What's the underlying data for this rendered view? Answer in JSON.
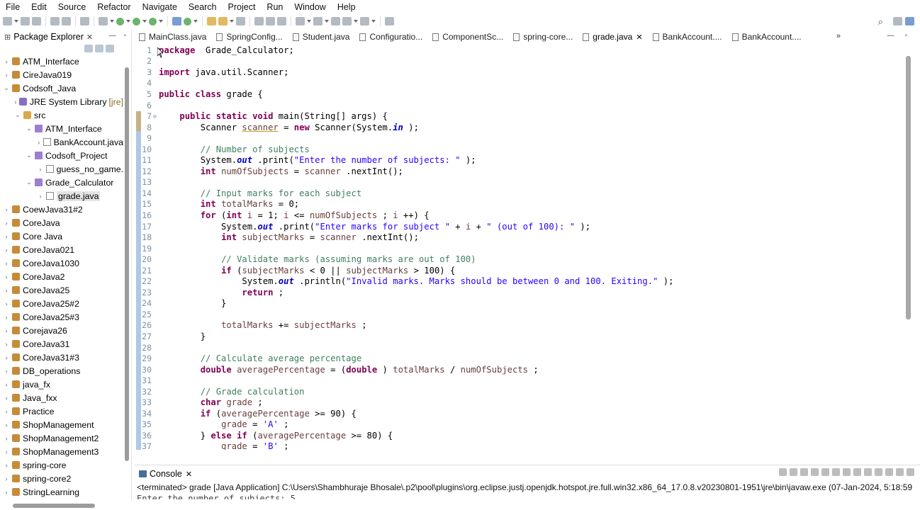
{
  "menu": [
    "File",
    "Edit",
    "Source",
    "Refactor",
    "Navigate",
    "Search",
    "Project",
    "Run",
    "Window",
    "Help"
  ],
  "package_explorer": {
    "title": "Package Explorer",
    "items": [
      {
        "label": "ATM_Interface",
        "depth": 0,
        "twisty": "›",
        "icon": "project"
      },
      {
        "label": "CireJava019",
        "depth": 0,
        "twisty": "›",
        "icon": "project"
      },
      {
        "label": "Codsoft_Java",
        "depth": 0,
        "twisty": "⌄",
        "icon": "project"
      },
      {
        "label": "JRE System Library",
        "decoration": "[jre]",
        "depth": 1,
        "twisty": "›",
        "icon": "library"
      },
      {
        "label": "src",
        "depth": 1,
        "twisty": "⌄",
        "icon": "source-folder"
      },
      {
        "label": "ATM_Interface",
        "depth": 2,
        "twisty": "⌄",
        "icon": "package"
      },
      {
        "label": "BankAccount.java",
        "depth": 3,
        "twisty": "›",
        "icon": "java-file"
      },
      {
        "label": "Codsoft_Project",
        "depth": 2,
        "twisty": "⌄",
        "icon": "package"
      },
      {
        "label": "guess_no_game.",
        "depth": 3,
        "twisty": "›",
        "icon": "java-file"
      },
      {
        "label": "Grade_Calculator",
        "depth": 2,
        "twisty": "⌄",
        "icon": "package"
      },
      {
        "label": "grade.java",
        "depth": 3,
        "twisty": "›",
        "icon": "java-file",
        "selected": true
      },
      {
        "label": "CoewJava31#2",
        "depth": 0,
        "twisty": "›",
        "icon": "project"
      },
      {
        "label": "CoreJava",
        "depth": 0,
        "twisty": "›",
        "icon": "project"
      },
      {
        "label": "Core Java",
        "depth": 0,
        "twisty": "›",
        "icon": "project"
      },
      {
        "label": "CoreJava021",
        "depth": 0,
        "twisty": "›",
        "icon": "project"
      },
      {
        "label": "CoreJava1030",
        "depth": 0,
        "twisty": "›",
        "icon": "project"
      },
      {
        "label": "CoreJava2",
        "depth": 0,
        "twisty": "›",
        "icon": "project"
      },
      {
        "label": "CoreJava25",
        "depth": 0,
        "twisty": "›",
        "icon": "project"
      },
      {
        "label": "CoreJava25#2",
        "depth": 0,
        "twisty": "›",
        "icon": "project"
      },
      {
        "label": "CoreJava25#3",
        "depth": 0,
        "twisty": "›",
        "icon": "project"
      },
      {
        "label": "Corejava26",
        "depth": 0,
        "twisty": "›",
        "icon": "project"
      },
      {
        "label": "CoreJava31",
        "depth": 0,
        "twisty": "›",
        "icon": "project"
      },
      {
        "label": "CoreJava31#3",
        "depth": 0,
        "twisty": "›",
        "icon": "project"
      },
      {
        "label": "DB_operations",
        "depth": 0,
        "twisty": "›",
        "icon": "project"
      },
      {
        "label": "java_fx",
        "depth": 0,
        "twisty": "›",
        "icon": "project"
      },
      {
        "label": "Java_fxx",
        "depth": 0,
        "twisty": "›",
        "icon": "project"
      },
      {
        "label": "Practice",
        "depth": 0,
        "twisty": "›",
        "icon": "project"
      },
      {
        "label": "ShopManagement",
        "depth": 0,
        "twisty": "›",
        "icon": "project"
      },
      {
        "label": "ShopManagement2",
        "depth": 0,
        "twisty": "›",
        "icon": "project"
      },
      {
        "label": "ShopManagement3",
        "depth": 0,
        "twisty": "›",
        "icon": "project"
      },
      {
        "label": "spring-core",
        "depth": 0,
        "twisty": "›",
        "icon": "project"
      },
      {
        "label": "spring-core2",
        "depth": 0,
        "twisty": "›",
        "icon": "project"
      },
      {
        "label": "StringLearning",
        "depth": 0,
        "twisty": "›",
        "icon": "project"
      }
    ]
  },
  "editor_tabs": [
    {
      "label": "MainClass.java",
      "active": false
    },
    {
      "label": "SpringConfig...",
      "active": false
    },
    {
      "label": "Student.java",
      "active": false
    },
    {
      "label": "Configuratio...",
      "active": false
    },
    {
      "label": "ComponentSc...",
      "active": false
    },
    {
      "label": "spring-core...",
      "active": false
    },
    {
      "label": "grade.java",
      "active": true
    },
    {
      "label": "BankAccount....",
      "active": false
    },
    {
      "label": "BankAccount....",
      "active": false
    }
  ],
  "tabs_overflow": "»",
  "code_lines": [
    {
      "n": "1",
      "fold": "",
      "tokens": [
        [
          "kw",
          "package"
        ],
        [
          "",
          "  Grade_Calculator;"
        ]
      ]
    },
    {
      "n": "2",
      "fold": "",
      "tokens": []
    },
    {
      "n": "3",
      "fold": "",
      "tokens": [
        [
          "kw",
          "import"
        ],
        [
          "",
          " java.util.Scanner;"
        ]
      ]
    },
    {
      "n": "4",
      "fold": "",
      "tokens": []
    },
    {
      "n": "5",
      "fold": "",
      "tokens": [
        [
          "kw",
          "public class"
        ],
        [
          "",
          " grade {"
        ]
      ]
    },
    {
      "n": "6",
      "fold": "",
      "tokens": []
    },
    {
      "n": "7",
      "fold": "⊖",
      "tokens": [
        [
          "",
          "    "
        ],
        [
          "kw",
          "public static void"
        ],
        [
          "",
          " main(String[] args) {"
        ]
      ]
    },
    {
      "n": "8",
      "fold": "",
      "tokens": [
        [
          "",
          "        Scanner "
        ],
        [
          "ul",
          "scanner"
        ],
        [
          "",
          " = "
        ],
        [
          "kw",
          "new"
        ],
        [
          "",
          " Scanner(System."
        ],
        [
          "fld",
          "in"
        ],
        [
          "",
          " );"
        ]
      ]
    },
    {
      "n": "9",
      "fold": "",
      "tokens": []
    },
    {
      "n": "10",
      "fold": "",
      "tokens": [
        [
          "",
          "        "
        ],
        [
          "cm",
          "// Number of subjects"
        ]
      ]
    },
    {
      "n": "11",
      "fold": "",
      "tokens": [
        [
          "",
          "        System."
        ],
        [
          "fld",
          "out"
        ],
        [
          "",
          " .print("
        ],
        [
          "st",
          "\"Enter the number of subjects: \""
        ],
        [
          "",
          " );"
        ]
      ]
    },
    {
      "n": "12",
      "fold": "",
      "tokens": [
        [
          "",
          "        "
        ],
        [
          "kw",
          "int"
        ],
        [
          "",
          " "
        ],
        [
          "vr",
          "numOfSubjects"
        ],
        [
          "",
          " = "
        ],
        [
          "vr",
          "scanner"
        ],
        [
          "",
          " .nextInt();"
        ]
      ]
    },
    {
      "n": "13",
      "fold": "",
      "tokens": []
    },
    {
      "n": "14",
      "fold": "",
      "tokens": [
        [
          "",
          "        "
        ],
        [
          "cm",
          "// Input marks for each subject"
        ]
      ]
    },
    {
      "n": "15",
      "fold": "",
      "tokens": [
        [
          "",
          "        "
        ],
        [
          "kw",
          "int"
        ],
        [
          "",
          " "
        ],
        [
          "vr",
          "totalMarks"
        ],
        [
          "",
          " = 0;"
        ]
      ]
    },
    {
      "n": "16",
      "fold": "",
      "tokens": [
        [
          "",
          "        "
        ],
        [
          "kw",
          "for"
        ],
        [
          "",
          " ("
        ],
        [
          "kw",
          "int"
        ],
        [
          "",
          " "
        ],
        [
          "vr",
          "i"
        ],
        [
          "",
          " = 1; "
        ],
        [
          "vr",
          "i"
        ],
        [
          "",
          " <= "
        ],
        [
          "vr",
          "numOfSubjects"
        ],
        [
          "",
          " ; "
        ],
        [
          "vr",
          "i"
        ],
        [
          "",
          " ++) {"
        ]
      ]
    },
    {
      "n": "17",
      "fold": "",
      "tokens": [
        [
          "",
          "            System."
        ],
        [
          "fld",
          "out"
        ],
        [
          "",
          " .print("
        ],
        [
          "st",
          "\"Enter marks for subject \""
        ],
        [
          "",
          " + "
        ],
        [
          "vr",
          "i"
        ],
        [
          "",
          " + "
        ],
        [
          "st",
          "\" (out of 100): \""
        ],
        [
          "",
          " );"
        ]
      ]
    },
    {
      "n": "18",
      "fold": "",
      "tokens": [
        [
          "",
          "            "
        ],
        [
          "kw",
          "int"
        ],
        [
          "",
          " "
        ],
        [
          "vr",
          "subjectMarks"
        ],
        [
          "",
          " = "
        ],
        [
          "vr",
          "scanner"
        ],
        [
          "",
          " .nextInt();"
        ]
      ]
    },
    {
      "n": "19",
      "fold": "",
      "tokens": []
    },
    {
      "n": "20",
      "fold": "",
      "tokens": [
        [
          "",
          "            "
        ],
        [
          "cm",
          "// Validate marks (assuming marks are out of 100)"
        ]
      ]
    },
    {
      "n": "21",
      "fold": "",
      "tokens": [
        [
          "",
          "            "
        ],
        [
          "kw",
          "if"
        ],
        [
          "",
          " ("
        ],
        [
          "vr",
          "subjectMarks"
        ],
        [
          "",
          " < 0 || "
        ],
        [
          "vr",
          "subjectMarks"
        ],
        [
          "",
          " > 100) {"
        ]
      ]
    },
    {
      "n": "22",
      "fold": "",
      "tokens": [
        [
          "",
          "                System."
        ],
        [
          "fld",
          "out"
        ],
        [
          "",
          " .println("
        ],
        [
          "st",
          "\"Invalid marks. Marks should be between 0 and 100. Exiting.\""
        ],
        [
          "",
          " );"
        ]
      ]
    },
    {
      "n": "23",
      "fold": "",
      "tokens": [
        [
          "",
          "                "
        ],
        [
          "kw",
          "return"
        ],
        [
          "",
          " ;"
        ]
      ]
    },
    {
      "n": "24",
      "fold": "",
      "tokens": [
        [
          "",
          "            }"
        ]
      ]
    },
    {
      "n": "25",
      "fold": "",
      "tokens": []
    },
    {
      "n": "26",
      "fold": "",
      "tokens": [
        [
          "",
          "            "
        ],
        [
          "vr",
          "totalMarks"
        ],
        [
          "",
          " += "
        ],
        [
          "vr",
          "subjectMarks"
        ],
        [
          "",
          " ;"
        ]
      ]
    },
    {
      "n": "27",
      "fold": "",
      "tokens": [
        [
          "",
          "        }"
        ]
      ]
    },
    {
      "n": "28",
      "fold": "",
      "tokens": []
    },
    {
      "n": "29",
      "fold": "",
      "tokens": [
        [
          "",
          "        "
        ],
        [
          "cm",
          "// Calculate average percentage"
        ]
      ]
    },
    {
      "n": "30",
      "fold": "",
      "tokens": [
        [
          "",
          "        "
        ],
        [
          "kw",
          "double"
        ],
        [
          "",
          " "
        ],
        [
          "vr",
          "averagePercentage"
        ],
        [
          "",
          " = ("
        ],
        [
          "kw",
          "double"
        ],
        [
          "",
          " ) "
        ],
        [
          "vr",
          "totalMarks"
        ],
        [
          "",
          " / "
        ],
        [
          "vr",
          "numOfSubjects"
        ],
        [
          "",
          " ;"
        ]
      ]
    },
    {
      "n": "31",
      "fold": "",
      "tokens": []
    },
    {
      "n": "32",
      "fold": "",
      "tokens": [
        [
          "",
          "        "
        ],
        [
          "cm",
          "// Grade calculation"
        ]
      ]
    },
    {
      "n": "33",
      "fold": "",
      "tokens": [
        [
          "",
          "        "
        ],
        [
          "kw",
          "char"
        ],
        [
          "",
          " "
        ],
        [
          "vr",
          "grade"
        ],
        [
          "",
          " ;"
        ]
      ]
    },
    {
      "n": "34",
      "fold": "",
      "tokens": [
        [
          "",
          "        "
        ],
        [
          "kw",
          "if"
        ],
        [
          "",
          " ("
        ],
        [
          "vr",
          "averagePercentage"
        ],
        [
          "",
          " >= 90) {"
        ]
      ]
    },
    {
      "n": "35",
      "fold": "",
      "tokens": [
        [
          "",
          "            "
        ],
        [
          "vr",
          "grade"
        ],
        [
          "",
          " = "
        ],
        [
          "st",
          "'A'"
        ],
        [
          "",
          " ;"
        ]
      ]
    },
    {
      "n": "36",
      "fold": "",
      "tokens": [
        [
          "",
          "        } "
        ],
        [
          "kw",
          "else if"
        ],
        [
          "",
          " ("
        ],
        [
          "vr",
          "averagePercentage"
        ],
        [
          "",
          " >= 80) {"
        ]
      ]
    },
    {
      "n": "37",
      "fold": "",
      "tokens": [
        [
          "",
          "            "
        ],
        [
          "vr",
          "grade"
        ],
        [
          "",
          " = "
        ],
        [
          "st",
          "'B'"
        ],
        [
          "",
          " ;"
        ]
      ]
    }
  ],
  "console": {
    "title": "Console",
    "status": "<terminated> grade [Java Application] C:\\Users\\Shambhuraje Bhosale\\.p2\\pool\\plugins\\org.eclipse.justj.openjdk.hotspot.jre.full.win32.x86_64_17.0.8.v20230801-1951\\jre\\bin\\javaw.exe  (07-Jan-2024, 5:18:59",
    "output": "Enter the number of subjects: 5"
  }
}
